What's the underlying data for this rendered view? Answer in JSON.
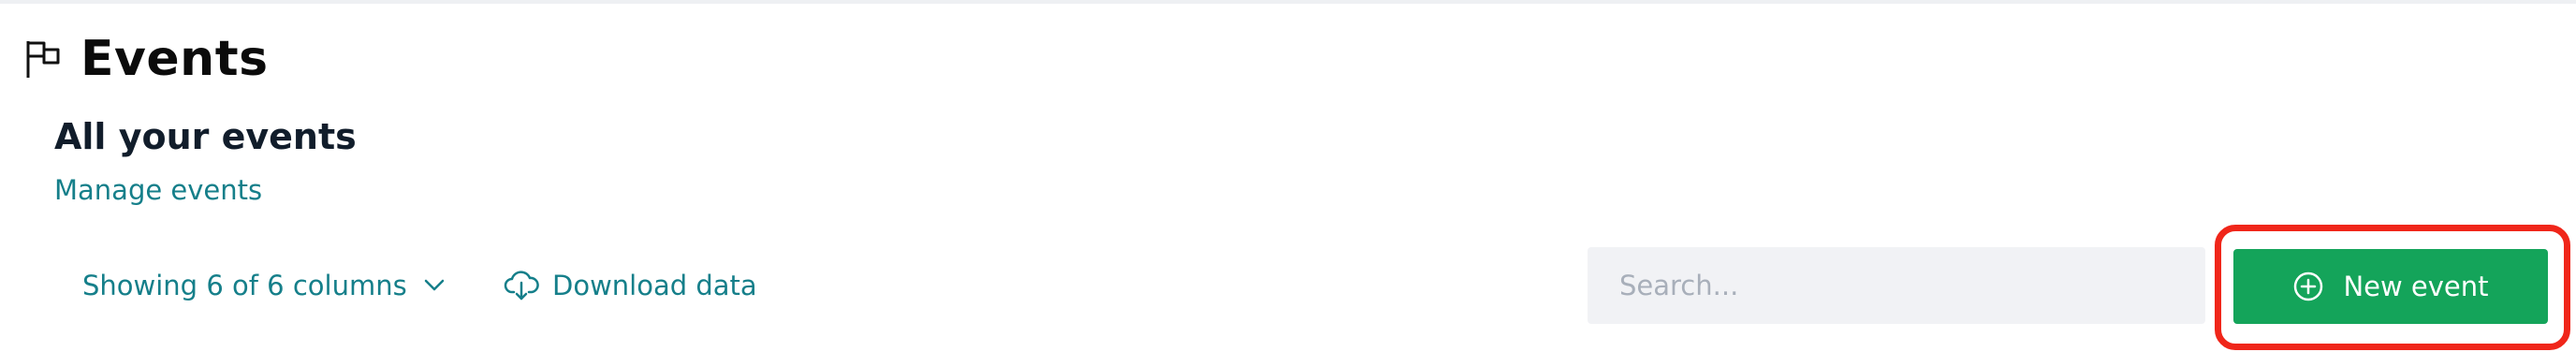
{
  "header": {
    "title": "Events",
    "icon": "flag-icon"
  },
  "section": {
    "title": "All your events",
    "manage_link": "Manage events"
  },
  "toolbar": {
    "columns_label": "Showing 6 of 6 columns",
    "columns_icon": "chevron-down-icon",
    "download_label": "Download data",
    "download_icon": "cloud-download-icon",
    "search_placeholder": "Search...",
    "new_event_label": "New event",
    "new_event_icon": "plus-circle-icon"
  },
  "colors": {
    "accent": "#157f8a",
    "primary_button": "#14a45a",
    "highlight": "#f0261a",
    "search_bg": "#f1f2f5"
  }
}
